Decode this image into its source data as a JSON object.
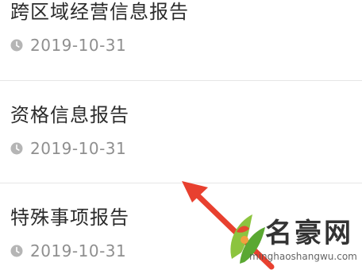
{
  "reports": [
    {
      "title": "跨区域经营信息报告",
      "date": "2019-10-31"
    },
    {
      "title": "资格信息报告",
      "date": "2019-10-31"
    },
    {
      "title": "特殊事项报告",
      "date": "2019-10-31"
    }
  ],
  "watermark": {
    "name": "名豪网",
    "url": "minghaoshangwu.com"
  },
  "colors": {
    "title_text": "#2b2b2b",
    "date_text": "#8f8f8f",
    "clock_icon": "#b5b5b5",
    "divider": "#e6e6e6",
    "annotation_arrow": "#e8402f"
  },
  "icons": {
    "date_icon": "clock-icon"
  }
}
